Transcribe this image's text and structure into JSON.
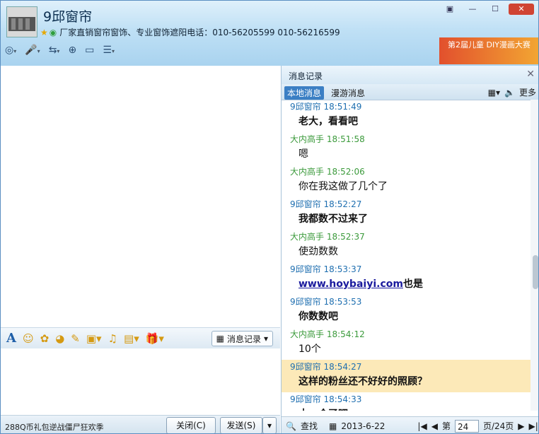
{
  "header": {
    "title": "9邱窗帘",
    "subtitle": "厂家直销窗帘窗饰、专业窗饰遮阳电话：010-56205599  010-56216599",
    "banner_text": "第2届儿童 DIY漫画大赛"
  },
  "toolbar": {
    "icons": [
      "camera-icon",
      "mic-icon",
      "transfer-icon",
      "add-contact-icon",
      "screen-share-icon",
      "app-menu-icon"
    ]
  },
  "input_toolbar": {
    "history_label": "消息记录"
  },
  "bottom": {
    "ad_text": "288Q币礼包逆战僵尸狂欢季",
    "close_label": "关闭(C)",
    "send_label": "发送(S)"
  },
  "side": {
    "title": "消息记录",
    "tabs": [
      "本地消息",
      "漫游消息"
    ],
    "more_label": "更多",
    "messages": [
      {
        "who": "9邱窗帘 18:51:49",
        "text": "老大，看看吧",
        "self": true
      },
      {
        "who": "大内高手 18:51:58",
        "text": "嗯",
        "self": false
      },
      {
        "who": "大内高手 18:52:06",
        "text": "你在我这做了几个了",
        "self": false
      },
      {
        "who": "9邱窗帘 18:52:27",
        "text": "我都数不过来了",
        "self": true
      },
      {
        "who": "大内高手 18:52:37",
        "text": "使劲数数",
        "self": false
      },
      {
        "who": "9邱窗帘 18:53:37",
        "link": "www.hoybaiyi.com",
        "text": "也是",
        "self": true
      },
      {
        "who": "9邱窗帘 18:53:53",
        "text": "你数数吧",
        "self": true
      },
      {
        "who": "大内高手 18:54:12",
        "text": "10个",
        "self": false
      },
      {
        "who": "9邱窗帘 18:54:27",
        "text": "这样的粉丝还不好好的照顾？",
        "self": true,
        "highlight": true
      },
      {
        "who": "9邱窗帘 18:54:33",
        "text": "十一个了吧",
        "self": true
      }
    ],
    "footer": {
      "search_label": "查找",
      "date": "2013-6-22",
      "page_prefix": "第",
      "page_value": "24",
      "page_suffix": "页/24页"
    }
  }
}
